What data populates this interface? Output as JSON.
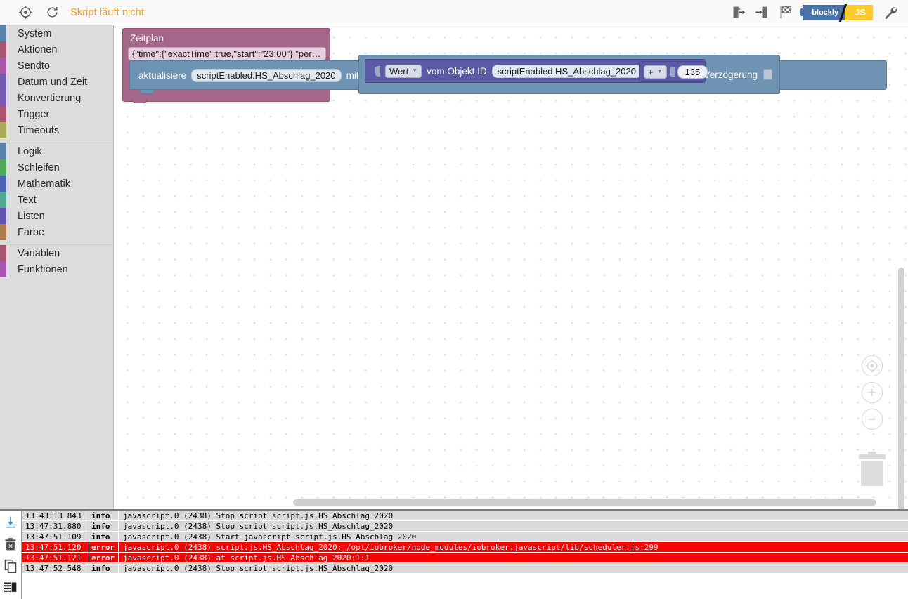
{
  "toolbar": {
    "locate_icon": "target-icon",
    "restart_icon": "refresh-icon",
    "status_text": "Skript läuft nicht",
    "status_color": "#f0a030",
    "export_icon": "export-icon",
    "import_icon": "import-icon",
    "flag_icon": "checkered-flag-icon",
    "mode_blockly_label": "blockly",
    "mode_js_label": "JS",
    "settings_icon": "wrench-icon"
  },
  "toolbox": {
    "groups": [
      {
        "items": [
          {
            "label": "System",
            "color": "#5a82ab"
          },
          {
            "label": "Aktionen",
            "color": "#a8566e"
          },
          {
            "label": "Sendto",
            "color": "#a856a8"
          },
          {
            "label": "Datum und Zeit",
            "color": "#6f5ab0"
          },
          {
            "label": "Konvertierung",
            "color": "#7a5ab0"
          },
          {
            "label": "Trigger",
            "color": "#a8566e"
          },
          {
            "label": "Timeouts",
            "color": "#a8ab54"
          }
        ]
      },
      {
        "items": [
          {
            "label": "Logik",
            "color": "#5a82ab"
          },
          {
            "label": "Schleifen",
            "color": "#4fa85a"
          },
          {
            "label": "Mathematik",
            "color": "#4d63ab"
          },
          {
            "label": "Text",
            "color": "#4faa8e"
          },
          {
            "label": "Listen",
            "color": "#5e55ab"
          },
          {
            "label": "Farbe",
            "color": "#b07a4d"
          }
        ]
      },
      {
        "items": [
          {
            "label": "Variablen",
            "color": "#a8566e"
          },
          {
            "label": "Funktionen",
            "color": "#a855b0"
          }
        ]
      }
    ]
  },
  "workspace": {
    "blocks": {
      "schedule": {
        "title": "Zeitplan",
        "schedule_value": "{\"time\":{\"exactTime\":true,\"start\":\"23:00\"},\"peri…",
        "color": "#a5678a"
      },
      "update": {
        "prefix_label": "aktualisiere",
        "object_id": "scriptEnabled.HS_Abschlag_2020",
        "suffix_label": "mit",
        "color": "#6f93b3"
      },
      "get_value": {
        "attribute": "Wert",
        "middle_label": "vom Objekt ID",
        "object_id": "scriptEnabled.HS_Abschlag_2020",
        "operator": "+",
        "number": "135",
        "color": "#5b5ba5"
      },
      "delay": {
        "label": "mit Verzögerung",
        "checked": false,
        "color": "#6f93b3"
      }
    },
    "controls": {
      "center_icon": "recenter-icon",
      "zoom_in_label": "+",
      "zoom_out_label": "−",
      "trash_icon": "trash-icon"
    }
  },
  "log": {
    "tools": [
      {
        "icon": "download-icon"
      },
      {
        "icon": "clear-log-icon"
      },
      {
        "icon": "copy-icon"
      },
      {
        "icon": "layout-icon"
      }
    ],
    "rows": [
      {
        "time": "13:43:13.843",
        "level": "info",
        "message": "javascript.0 (2438) Stop script script.js.HS_Abschlag_2020"
      },
      {
        "time": "13:47:31.880",
        "level": "info",
        "message": "javascript.0 (2438) Stop script script.js.HS_Abschlag_2020"
      },
      {
        "time": "13:47:51.109",
        "level": "info",
        "message": "javascript.0 (2438) Start javascript script.js.HS_Abschlag_2020"
      },
      {
        "time": "13:47:51.120",
        "level": "error",
        "message": "javascript.0 (2438) script.js.HS_Abschlag_2020: /opt/iobroker/node_modules/iobroker.javascript/lib/scheduler.js:299"
      },
      {
        "time": "13:47:51.121",
        "level": "error",
        "message": "javascript.0 (2438) at script.js.HS_Abschlag_2020:1:1"
      },
      {
        "time": "13:47:52.548",
        "level": "info",
        "message": "javascript.0 (2438) Stop script script.js.HS_Abschlag_2020"
      }
    ]
  }
}
